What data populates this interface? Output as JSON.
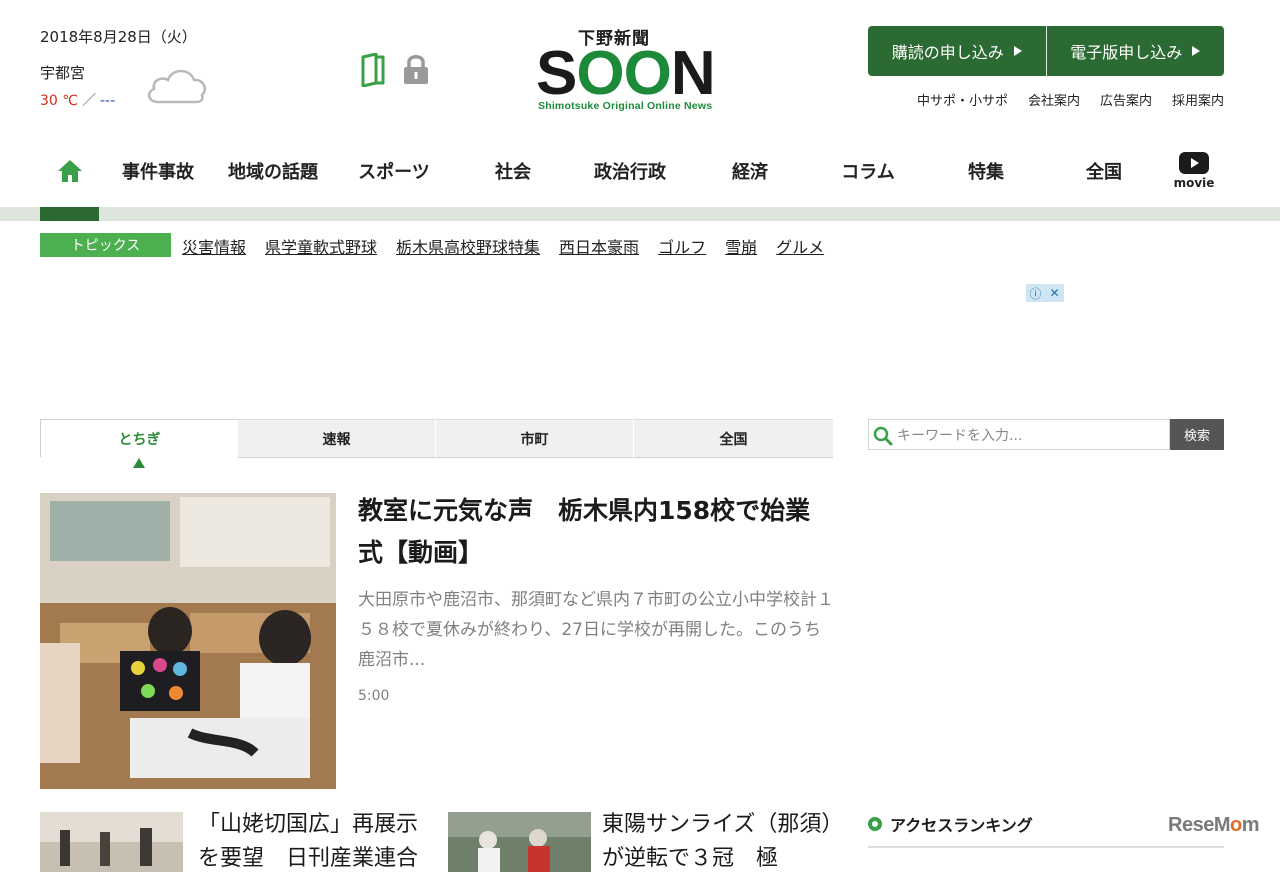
{
  "header": {
    "date": "2018年8月28日（火）",
    "weather": {
      "city": "宇都宮",
      "high": "30 ℃",
      "separator": "／",
      "low": "---",
      "icon": "cloud-icon"
    },
    "icons": [
      "book-icon",
      "lock-icon"
    ],
    "logo": {
      "top": "下野新聞",
      "main_prefix": "S",
      "main_green": "OO",
      "main_suffix": "N",
      "tagline": "Shimotsuke Original Online News"
    },
    "subscribe_buttons": [
      {
        "label": "購読の申し込み"
      },
      {
        "label": "電子版申し込み"
      }
    ],
    "util_links": [
      "中サポ・小サポ",
      "会社案内",
      "広告案内",
      "採用案内"
    ]
  },
  "nav": {
    "home_icon": "home-icon",
    "items": [
      "事件事故",
      "地域の話題",
      "スポーツ",
      "社会",
      "政治行政",
      "経済",
      "コラム",
      "特集",
      "全国"
    ],
    "movie_label": "movie",
    "movie_icon": "play-icon"
  },
  "topics": {
    "label": "トピックス",
    "links": [
      "災害情報",
      "県学童軟式野球",
      "栃木県高校野球特集",
      "西日本豪雨",
      "ゴルフ",
      "雪崩",
      "グルメ"
    ]
  },
  "tabs": [
    "とちぎ",
    "速報",
    "市町",
    "全国"
  ],
  "search": {
    "placeholder": "キーワードを入力...",
    "button": "検索"
  },
  "lead_article": {
    "title": "教室に元気な声　栃木県内158校で始業式【動画】",
    "summary": "大田原市や鹿沼市、那須町など県内７市町の公立小中学校計１５８校で夏休みが終わり、27日に学校が再開した。このうち鹿沼市...",
    "time": "5:00"
  },
  "sub_articles": [
    {
      "title": "「山姥切国広」再展示を要望　日刊産業連合"
    },
    {
      "title": "東陽サンライズ（那須）が逆転で３冠　極"
    }
  ],
  "sidebar": {
    "ranking_title": "アクセスランキング"
  },
  "watermark": {
    "pre": "Rese",
    "m": "M",
    "o": "o",
    "post": "m"
  },
  "colors": {
    "brand_green": "#2b6b33",
    "accent_green": "#4caf50",
    "temp_high": "#d62a1f",
    "temp_low": "#1f4fb0"
  }
}
